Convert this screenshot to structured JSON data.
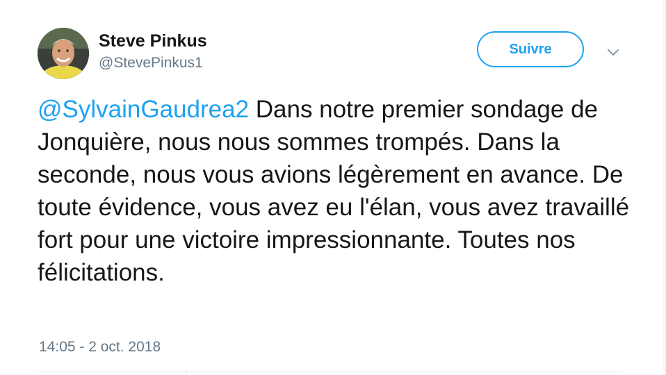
{
  "author": {
    "name": "Steve Pinkus",
    "handle": "@StevePinkus1",
    "avatar_icon": "profile-photo"
  },
  "follow_button": {
    "label": "Suivre"
  },
  "menu_icon": "chevron-down-icon",
  "tweet": {
    "mention": "@SylvainGaudrea2",
    "body": " Dans notre premier sondage de Jonquière, nous nous sommes trompés. Dans la seconde, nous vous avions légèrement en avance. De toute évidence, vous avez eu l'élan, vous avez travaillé fort pour une victoire impressionnante. Toutes nos félicitations.",
    "timestamp": "14:05 - 2 oct. 2018"
  },
  "colors": {
    "accent": "#1da1f2",
    "text": "#14171a",
    "secondary": "#657786",
    "divider": "#e6ecf0"
  }
}
